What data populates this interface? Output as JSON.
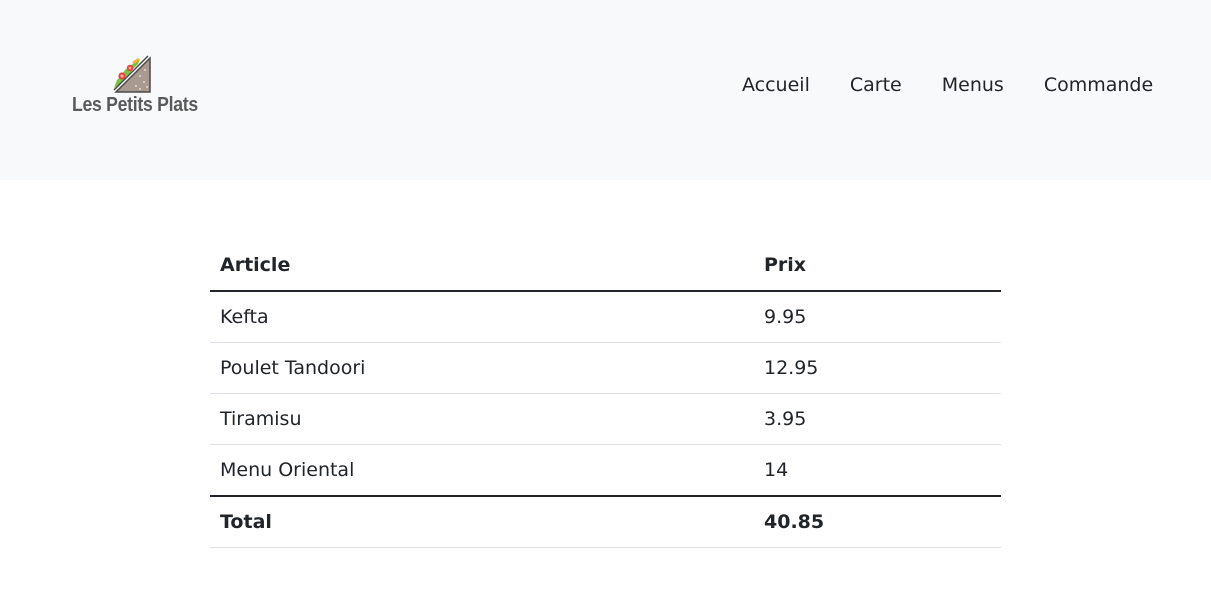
{
  "header": {
    "logo_text": "Les Petits Plats",
    "nav": [
      {
        "label": "Accueil"
      },
      {
        "label": "Carte"
      },
      {
        "label": "Menus"
      },
      {
        "label": "Commande"
      }
    ]
  },
  "order_table": {
    "columns": [
      "Article",
      "Prix"
    ],
    "rows": [
      {
        "article": "Kefta",
        "price": "9.95"
      },
      {
        "article": "Poulet Tandoori",
        "price": "12.95"
      },
      {
        "article": "Tiramisu",
        "price": "3.95"
      },
      {
        "article": "Menu Oriental",
        "price": "14"
      }
    ],
    "total_label": "Total",
    "total_value": "40.85"
  },
  "colors": {
    "header_bg": "#f8f9fa",
    "text": "#212529",
    "logo_text": "#5a5a5a",
    "row_divider": "#dee2e6"
  }
}
